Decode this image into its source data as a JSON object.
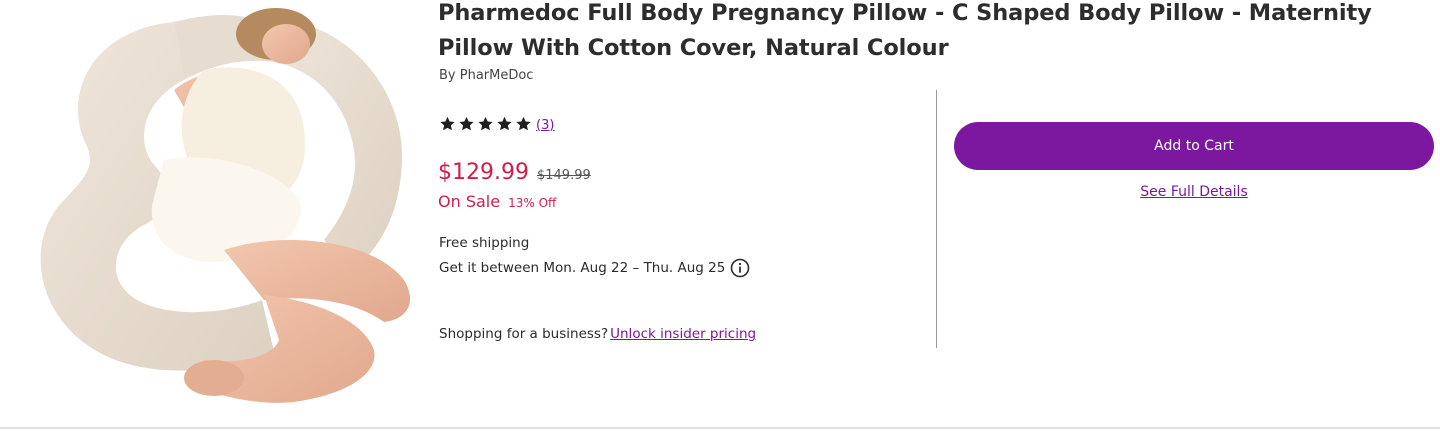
{
  "product": {
    "title": "Pharmedoc Full Body Pregnancy Pillow - C Shaped Body Pillow - Maternity Pillow With Cotton Cover, Natural Colour",
    "brand": "By PharMeDoc",
    "rating": 5,
    "rating_max": 5,
    "review_count": "(3)",
    "sale_price": "$129.99",
    "original_price": "$149.99",
    "sale_label": "On Sale",
    "discount": "13% Off",
    "shipping": "Free shipping",
    "delivery": "Get it between Mon. Aug 22 – Thu. Aug 25",
    "business_prompt": "Shopping for a business?",
    "business_link": "Unlock insider pricing"
  },
  "actions": {
    "add_to_cart": "Add to Cart",
    "see_details": "See Full Details"
  },
  "colors": {
    "accent": "#7b189f",
    "sale": "#cf1d4d",
    "pillow": "#e9dfd2",
    "text": "#2b2b2b"
  },
  "icons": {
    "rating": "star-icon",
    "delivery_info": "info-icon"
  }
}
